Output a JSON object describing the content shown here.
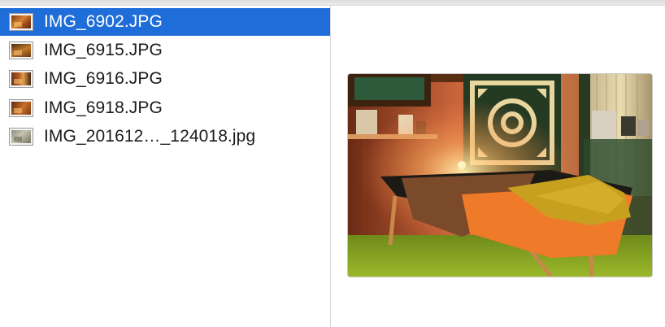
{
  "file_list": {
    "items": [
      {
        "name": "IMG_6902.JPG",
        "selected": true,
        "thumb_icon": "photo-thumbnail-icon"
      },
      {
        "name": "IMG_6915.JPG",
        "selected": false,
        "thumb_icon": "photo-thumbnail-icon"
      },
      {
        "name": "IMG_6916.JPG",
        "selected": false,
        "thumb_icon": "photo-thumbnail-icon"
      },
      {
        "name": "IMG_6918.JPG",
        "selected": false,
        "thumb_icon": "photo-thumbnail-icon"
      },
      {
        "name": "IMG_201612…_124018.jpg",
        "selected": false,
        "thumb_icon": "photo-thumbnail-icon"
      }
    ]
  },
  "colors": {
    "selection": "#1e6dd8",
    "selected_text": "#ffffff",
    "text": "#1c1c1c"
  },
  "preview": {
    "icon": "photo-preview-image"
  }
}
